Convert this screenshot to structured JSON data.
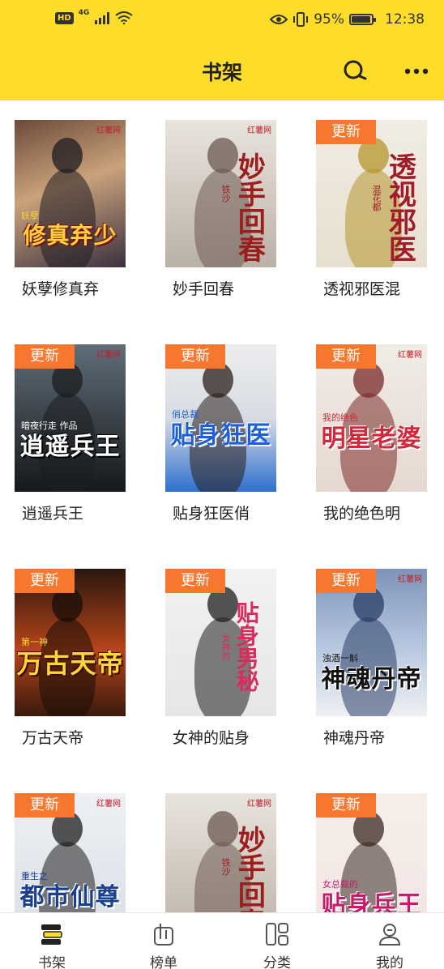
{
  "status_bar": {
    "hd": "HD",
    "network": "4G",
    "battery_percent": "95%",
    "battery_level": 0.95,
    "time": "12:38"
  },
  "header": {
    "title": "书架",
    "search_icon": "search-icon",
    "more_icon": "more-icon"
  },
  "colors": {
    "header_bg": "#fddc2a",
    "badge_bg": "#f8772e",
    "nav_active": "#fddc2a"
  },
  "books": [
    {
      "title": "妖孽修真弃",
      "cover_text": "修真弃少",
      "cover_sub": "妖孽",
      "cover_brand": "红薯网",
      "badge": ""
    },
    {
      "title": "妙手回春",
      "cover_text": "妙手回春",
      "cover_sub": "铁沙",
      "cover_brand": "红薯网",
      "badge": ""
    },
    {
      "title": "透视邪医混",
      "cover_text": "透视邪医",
      "cover_sub": "混花都",
      "cover_brand": "",
      "badge": "更新"
    },
    {
      "title": "逍遥兵王",
      "cover_text": "逍遥兵王",
      "cover_sub": "暗夜行走 作品",
      "cover_brand": "红薯网",
      "badge": "更新"
    },
    {
      "title": "贴身狂医俏",
      "cover_text": "贴身狂医",
      "cover_sub": "俏总裁",
      "cover_brand": "",
      "badge": "更新"
    },
    {
      "title": "我的绝色明",
      "cover_text": "明星老婆",
      "cover_sub": "我的绝色",
      "cover_brand": "红薯网",
      "badge": "更新"
    },
    {
      "title": "万古天帝",
      "cover_text": "万古天帝",
      "cover_sub": "第一神",
      "cover_brand": "",
      "badge": "更新"
    },
    {
      "title": "女神的贴身",
      "cover_text": "贴身男秘",
      "cover_sub": "女神的",
      "cover_brand": "",
      "badge": "更新"
    },
    {
      "title": "神魂丹帝",
      "cover_text": "神魂丹帝",
      "cover_sub": "浊酒一斛",
      "cover_brand": "红薯网",
      "badge": "更新"
    },
    {
      "title": "",
      "cover_text": "都市仙尊",
      "cover_sub": "重生之",
      "cover_brand": "红薯网",
      "badge": "更新"
    },
    {
      "title": "",
      "cover_text": "妙手回春",
      "cover_sub": "铁沙",
      "cover_brand": "红薯网",
      "badge": ""
    },
    {
      "title": "",
      "cover_text": "贴身兵王",
      "cover_sub": "女总裁的",
      "cover_brand": "",
      "badge": "更新"
    }
  ],
  "bottom_nav": [
    {
      "label": "书架",
      "icon": "bookshelf-icon",
      "active": true
    },
    {
      "label": "榜单",
      "icon": "ranking-icon",
      "active": false
    },
    {
      "label": "分类",
      "icon": "category-icon",
      "active": false
    },
    {
      "label": "我的",
      "icon": "profile-icon",
      "active": false
    }
  ]
}
